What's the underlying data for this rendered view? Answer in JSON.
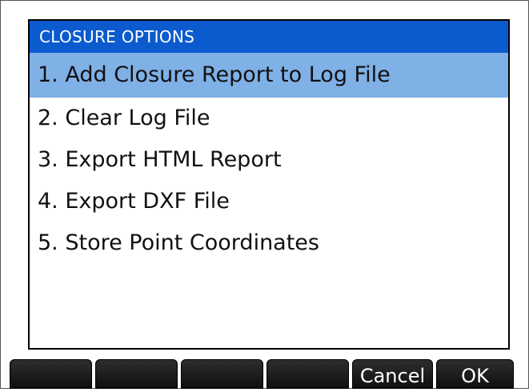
{
  "dialog": {
    "title": "CLOSURE OPTIONS",
    "items": [
      {
        "label": "1. Add Closure Report to Log File",
        "selected": true
      },
      {
        "label": "2. Clear Log File",
        "selected": false
      },
      {
        "label": "3. Export HTML Report",
        "selected": false
      },
      {
        "label": "4. Export DXF File",
        "selected": false
      },
      {
        "label": "5. Store Point Coordinates",
        "selected": false
      }
    ]
  },
  "softkeys": {
    "key1": "",
    "key2": "",
    "key3": "",
    "key4": "",
    "cancel": "Cancel",
    "ok": "OK"
  },
  "colors": {
    "title_bar": "#0b5bcf",
    "selection": "#7fb0e6",
    "softkey": "#1a1a1a"
  }
}
